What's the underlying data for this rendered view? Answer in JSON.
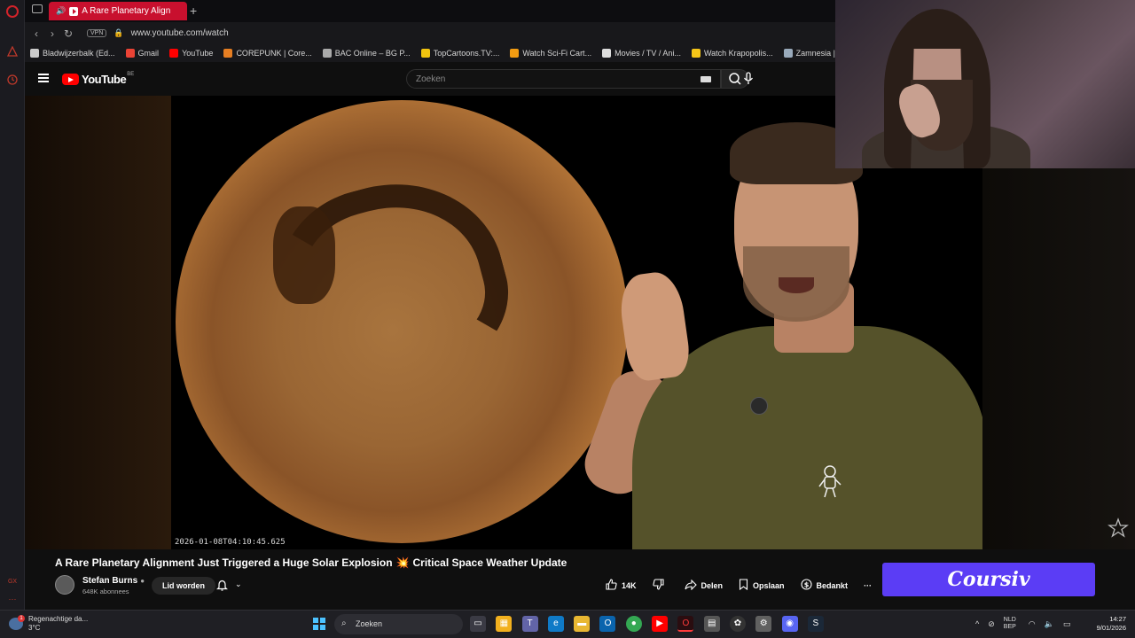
{
  "browser": {
    "tab": {
      "title": "A Rare Planetary Align"
    },
    "address": {
      "url": "www.youtube.com/watch",
      "vpn_label": "VPN"
    },
    "bookmarks": [
      {
        "label": "Bladwijzerbalk (Ed...",
        "icon": "folder-icon",
        "color": "#cccccc"
      },
      {
        "label": "Gmail",
        "icon": "gmail-icon",
        "color": "#ea4335"
      },
      {
        "label": "YouTube",
        "icon": "youtube-icon",
        "color": "#ff0000"
      },
      {
        "label": "COREPUNK | Core...",
        "icon": "corepunk-icon",
        "color": "#e67e22"
      },
      {
        "label": "BAC Online – BG P...",
        "icon": "bac-icon",
        "color": "#aaaaaa"
      },
      {
        "label": "TopCartoons.TV:...",
        "icon": "topcartoons-icon",
        "color": "#f1c40f"
      },
      {
        "label": "Watch Sci-Fi Cart...",
        "icon": "scifi-icon",
        "color": "#f39c12"
      },
      {
        "label": "Movies / TV / Ani...",
        "icon": "play-icon",
        "color": "#dddddd"
      },
      {
        "label": "Watch Krapopolis...",
        "icon": "krapopolis-icon",
        "color": "#f5c518"
      },
      {
        "label": "Zamnesia | Het Be",
        "icon": "zamnesia-icon",
        "color": "#9ab"
      }
    ]
  },
  "youtube": {
    "logo_text": "YouTube",
    "country_code": "BE",
    "search_placeholder": "Zoeken"
  },
  "video": {
    "overlay_timestamp": "2026-01-08T04:10:45.625",
    "title": "A Rare Planetary Alignment Just Triggered a Huge Solar Explosion",
    "title_emoji": "💥",
    "title_suffix": "Critical Space Weather Update",
    "channel": {
      "name": "Stefan Burns",
      "subscribers": "648K abonnees"
    },
    "join_label": "Lid worden",
    "actions": {
      "like_count": "14K",
      "share_label": "Delen",
      "save_label": "Opslaan",
      "thanks_label": "Bedankt",
      "more_label": "···"
    },
    "sponsor_banner": "Coursiv"
  },
  "taskbar": {
    "weather": {
      "condition": "Regenachtige da...",
      "temp": "3°C",
      "badge": "1"
    },
    "search_placeholder": "Zoeken",
    "language": {
      "line1": "NLD",
      "line2": "BEP"
    },
    "time": "14:27",
    "date": "9/01/2026"
  }
}
